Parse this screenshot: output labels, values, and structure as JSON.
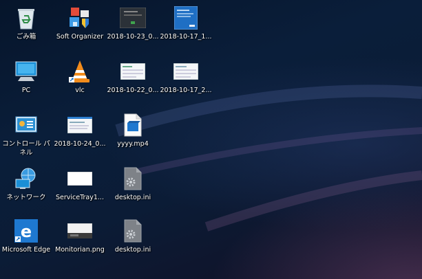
{
  "desktop": {
    "icons": [
      {
        "label": "ごみ箱",
        "icon": "recycle-bin-icon"
      },
      {
        "label": "PC",
        "icon": "pc-monitor-icon"
      },
      {
        "label": "コントロール パネル",
        "icon": "control-panel-icon"
      },
      {
        "label": "ネットワーク",
        "icon": "network-globe-icon"
      },
      {
        "label": "Microsoft Edge",
        "icon": "edge-browser-icon"
      },
      {
        "label": "Soft Organizer",
        "icon": "soft-organizer-icon"
      },
      {
        "label": "vlc",
        "icon": "vlc-cone-icon"
      },
      {
        "label": "2018-10-24_0...",
        "icon": "image-thumbnail-icon"
      },
      {
        "label": "ServiceTray1...",
        "icon": "image-thumbnail-icon"
      },
      {
        "label": "Monitorian.png",
        "icon": "image-thumbnail-icon"
      },
      {
        "label": "2018-10-23_0...",
        "icon": "image-thumbnail-icon"
      },
      {
        "label": "2018-10-22_0...",
        "icon": "image-thumbnail-icon"
      },
      {
        "label": "yyyy.mp4",
        "icon": "video-file-icon"
      },
      {
        "label": "desktop.ini",
        "icon": "settings-file-icon"
      },
      {
        "label": "desktop.ini",
        "icon": "settings-file-icon"
      },
      {
        "label": "2018-10-17_1...",
        "icon": "image-thumbnail-icon"
      },
      {
        "label": "2018-10-17_2...",
        "icon": "image-thumbnail-icon"
      }
    ]
  }
}
